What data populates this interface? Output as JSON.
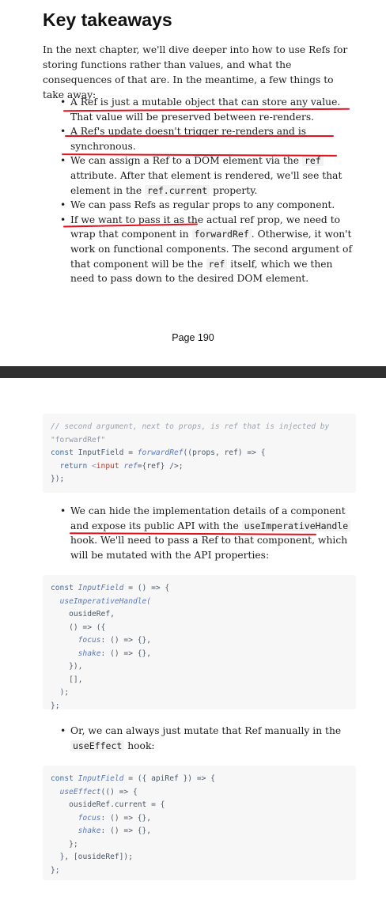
{
  "page1": {
    "heading": "Key takeaways",
    "intro": "In the next chapter, we'll dive deeper into how to use Refs for storing functions rather than values, and what the consequences of that are. In the meantime, a few things to take away:",
    "bullets": {
      "b1": "A Ref is just a mutable object that can store any value. That value will be preserved between re-renders.",
      "b2": "A Ref's update doesn't trigger re-renders and is synchronous.",
      "b3_pre": "We can assign a Ref to a DOM element via the ",
      "b3_code1": "ref",
      "b3_mid": " attribute. After that element is rendered, we'll see that element in the ",
      "b3_code2": "ref.current",
      "b3_post": " property.",
      "b4": "We can pass Refs as regular props to any component.",
      "b5_pre": "If we want to pass it as the actual ref prop, we need to wrap that component in ",
      "b5_code1": "forwardRef",
      "b5_mid": ". Otherwise, it won't work on functional components. The second argument of that component will be the ",
      "b5_code2": "ref",
      "b5_post": " itself, which we then need to pass down to the desired DOM element."
    },
    "page_number": "Page 190"
  },
  "page2": {
    "code1": {
      "line1": "// second argument, next to props, is ref that is injected by",
      "line2": "\"forwardRef\"",
      "line3_const": "const",
      "line3_name": " InputField = ",
      "line3_fn": "forwardRef",
      "line3_rest": "((props, ref) => {",
      "line4_return": "return",
      "line4_open": " <",
      "line4_tag": "input",
      "line4_attr": " ref",
      "line4_rest": "={ref} />;",
      "line5": "});"
    },
    "bullet2_pre": "We can hide the implementation details of a component and expose its public API with the ",
    "bullet2_code": "useImperativeHandle",
    "bullet2_post": " hook. We'll need to pass a Ref to that component, which will be mutated with the API properties:",
    "code2": {
      "l1_const": "const",
      "l1_name": " InputField",
      "l1_rest": " = () => {",
      "l2": "useImperativeHandle(",
      "l3": "ousideRef,",
      "l4": "() => ({",
      "l5_key": "focus",
      "l5_rest": ": () => {},",
      "l6_key": "shake",
      "l6_rest": ": () => {},",
      "l7": "}),",
      "l8": "[],",
      "l9": ");",
      "l10": "};"
    },
    "bullet3_pre": "Or, we can always just mutate that Ref manually in the ",
    "bullet3_code": "useEffect",
    "bullet3_post": " hook:",
    "code3": {
      "l1_const": "const",
      "l1_name": " InputField",
      "l1_rest": " = ({ apiRef }) => {",
      "l2_fn": "useEffect",
      "l2_rest": "(() => {",
      "l3": "ousideRef.current = {",
      "l4_key": "focus",
      "l4_rest": ": () => {},",
      "l5_key": "shake",
      "l5_rest": ": () => {},",
      "l6": "};",
      "l7": "}, [ousideRef]);",
      "l8": "};"
    }
  },
  "colors": {
    "underline": "#e3101e",
    "divider": "#2f2f2f",
    "code_bg": "#f7f7f7"
  }
}
